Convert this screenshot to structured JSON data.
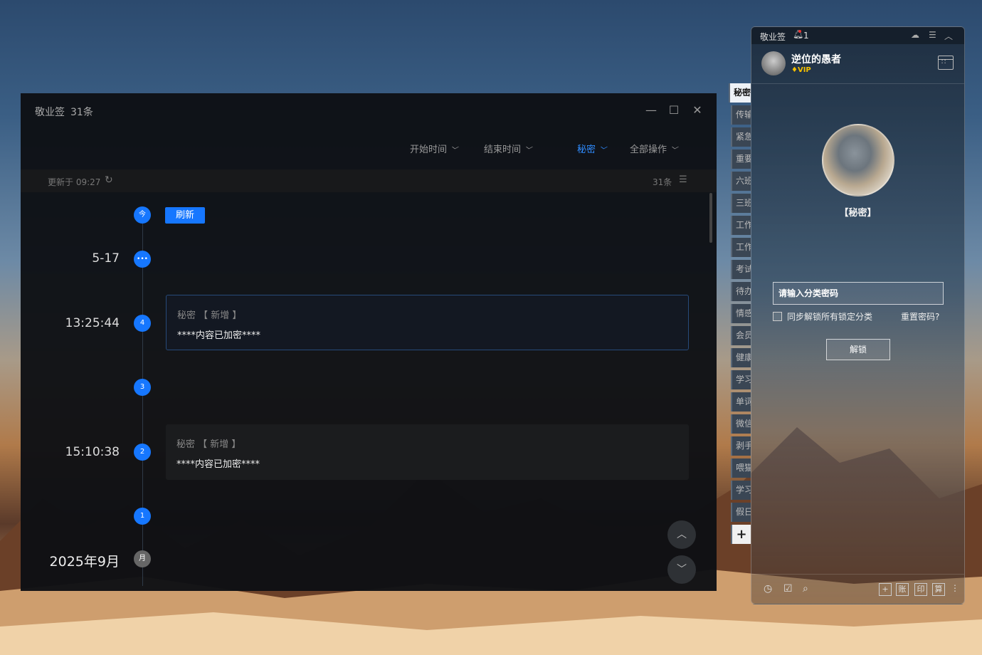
{
  "main": {
    "app_title": "敬业签",
    "count_label": "31条",
    "filters": {
      "start_time": "开始时间",
      "end_time": "结束时间",
      "category": "秘密",
      "all_ops": "全部操作"
    },
    "info": {
      "updated": "更新于 09:27",
      "count": "31条"
    },
    "refresh_label": "刷新",
    "timeline": {
      "today_badge": "今",
      "more_badge": "•••",
      "date_1": "5-17",
      "time_1": "13:25:44",
      "badge_4": "4",
      "badge_3": "3",
      "time_2": "15:10:38",
      "badge_2": "2",
      "badge_1": "1",
      "month_label": "2025年9月",
      "month_badge": "月"
    },
    "cards": [
      {
        "head": "秘密 【 新增 】",
        "body": "****内容已加密****"
      },
      {
        "head": "秘密 【 新增 】",
        "body": "****内容已加密****"
      }
    ]
  },
  "side_tabs": [
    "秘密",
    "传输",
    "紧急",
    "重要",
    "六班",
    "三班",
    "工作",
    "工作",
    "考试",
    "待办",
    "情感",
    "会员",
    "健康",
    "学习",
    "单词",
    "微信",
    "剥手",
    "喂猫",
    "学习",
    "假日"
  ],
  "panel": {
    "title": "敬业签",
    "bell_count": "1",
    "user_name": "逆位的愚者",
    "vip": "VIP",
    "category_label": "【秘密】",
    "password_placeholder": "请输入分类密码",
    "sync_label": "同步解锁所有锁定分类",
    "reset_label": "重置密码?",
    "unlock_label": "解锁",
    "bottom_boxes": [
      "账",
      "印",
      "算"
    ]
  }
}
